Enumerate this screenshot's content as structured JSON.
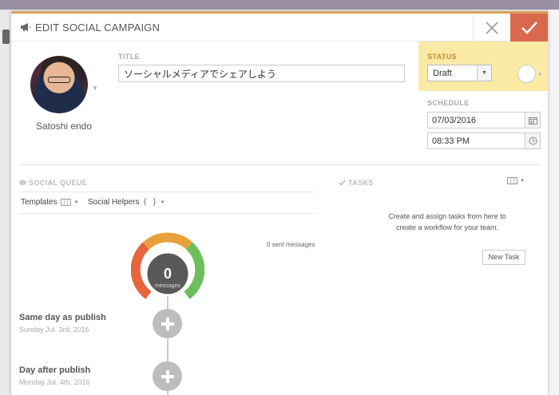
{
  "header": {
    "title": "EDIT SOCIAL CAMPAIGN",
    "icon": "megaphone-icon",
    "close_icon": "close-icon",
    "confirm_icon": "checkmark-icon",
    "confirm_color": "#d9694e",
    "accent_color": "#d8a25a"
  },
  "profile": {
    "name": "Satoshi endo"
  },
  "title_field": {
    "label": "TITLE",
    "value": "ソーシャルメディアでシェアしよう"
  },
  "status": {
    "label": "STATUS",
    "selected": "Draft",
    "panel_color": "#fbe9a6"
  },
  "schedule": {
    "label": "SCHEDULE",
    "date": "07/03/2016",
    "time": "08:33 PM"
  },
  "social_queue": {
    "label": "SOCIAL QUEUE",
    "templates_label": "Templates",
    "helpers_label": "Social Helpers",
    "helpers_glyph": "{ }",
    "sent_messages": "0 sent messages",
    "gauge": {
      "count": "0",
      "unit": "messages",
      "colors": [
        "#e8643c",
        "#e8a13a",
        "#6cbf5b"
      ]
    },
    "events": [
      {
        "title": "Same day as publish",
        "date": "Sunday Jul. 3rd, 2016"
      },
      {
        "title": "Day after publish",
        "date": "Monday Jul. 4th, 2016"
      }
    ]
  },
  "tasks": {
    "label": "TASKS",
    "text_line1": "Create and assign tasks from here to",
    "text_line2": "create a workflow for your team.",
    "new_task_label": "New Task"
  }
}
